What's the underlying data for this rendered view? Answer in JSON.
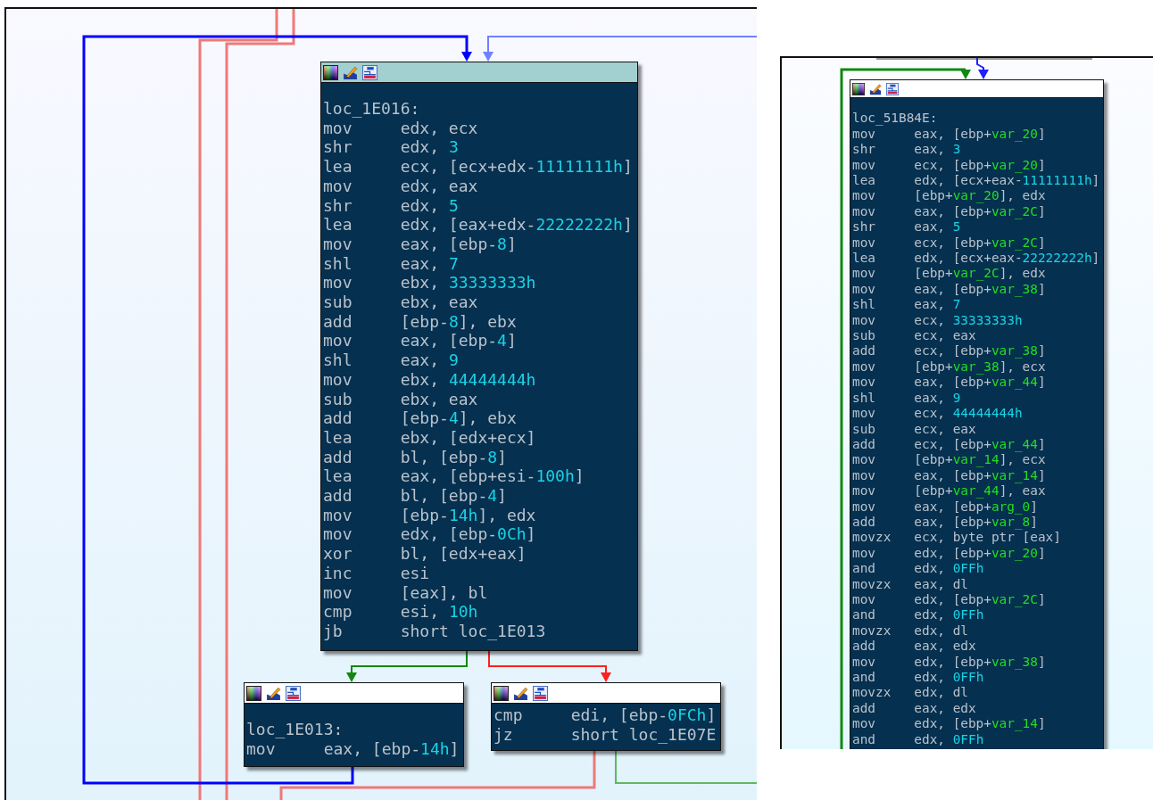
{
  "panels": [
    {
      "blocks": [
        {
          "selected": true,
          "label": "loc_1E016:",
          "lines": [
            {
              "mnemonic": "mov",
              "operands": [
                {
                  "text": "edx, ecx",
                  "kind": "plain"
                }
              ]
            },
            {
              "mnemonic": "shr",
              "operands": [
                {
                  "text": "edx, ",
                  "kind": "plain"
                },
                {
                  "text": "3",
                  "kind": "num"
                }
              ]
            },
            {
              "mnemonic": "lea",
              "operands": [
                {
                  "text": "ecx, [ecx+edx-",
                  "kind": "plain"
                },
                {
                  "text": "11111111h",
                  "kind": "num"
                },
                {
                  "text": "]",
                  "kind": "plain"
                }
              ]
            },
            {
              "mnemonic": "mov",
              "operands": [
                {
                  "text": "edx, eax",
                  "kind": "plain"
                }
              ]
            },
            {
              "mnemonic": "shr",
              "operands": [
                {
                  "text": "edx, ",
                  "kind": "plain"
                },
                {
                  "text": "5",
                  "kind": "num"
                }
              ]
            },
            {
              "mnemonic": "lea",
              "operands": [
                {
                  "text": "edx, [eax+edx-",
                  "kind": "plain"
                },
                {
                  "text": "22222222h",
                  "kind": "num"
                },
                {
                  "text": "]",
                  "kind": "plain"
                }
              ]
            },
            {
              "mnemonic": "mov",
              "operands": [
                {
                  "text": "eax, [ebp-",
                  "kind": "plain"
                },
                {
                  "text": "8",
                  "kind": "num"
                },
                {
                  "text": "]",
                  "kind": "plain"
                }
              ]
            },
            {
              "mnemonic": "shl",
              "operands": [
                {
                  "text": "eax, ",
                  "kind": "plain"
                },
                {
                  "text": "7",
                  "kind": "num"
                }
              ]
            },
            {
              "mnemonic": "mov",
              "operands": [
                {
                  "text": "ebx, ",
                  "kind": "plain"
                },
                {
                  "text": "33333333h",
                  "kind": "num"
                }
              ]
            },
            {
              "mnemonic": "sub",
              "operands": [
                {
                  "text": "ebx, eax",
                  "kind": "plain"
                }
              ]
            },
            {
              "mnemonic": "add",
              "operands": [
                {
                  "text": "[ebp-",
                  "kind": "plain"
                },
                {
                  "text": "8",
                  "kind": "num"
                },
                {
                  "text": "], ebx",
                  "kind": "plain"
                }
              ]
            },
            {
              "mnemonic": "mov",
              "operands": [
                {
                  "text": "eax, [ebp-",
                  "kind": "plain"
                },
                {
                  "text": "4",
                  "kind": "num"
                },
                {
                  "text": "]",
                  "kind": "plain"
                }
              ]
            },
            {
              "mnemonic": "shl",
              "operands": [
                {
                  "text": "eax, ",
                  "kind": "plain"
                },
                {
                  "text": "9",
                  "kind": "num"
                }
              ]
            },
            {
              "mnemonic": "mov",
              "operands": [
                {
                  "text": "ebx, ",
                  "kind": "plain"
                },
                {
                  "text": "44444444h",
                  "kind": "num"
                }
              ]
            },
            {
              "mnemonic": "sub",
              "operands": [
                {
                  "text": "ebx, eax",
                  "kind": "plain"
                }
              ]
            },
            {
              "mnemonic": "add",
              "operands": [
                {
                  "text": "[ebp-",
                  "kind": "plain"
                },
                {
                  "text": "4",
                  "kind": "num"
                },
                {
                  "text": "], ebx",
                  "kind": "plain"
                }
              ]
            },
            {
              "mnemonic": "lea",
              "operands": [
                {
                  "text": "ebx, [edx+ecx]",
                  "kind": "plain"
                }
              ]
            },
            {
              "mnemonic": "add",
              "operands": [
                {
                  "text": "bl, [ebp-",
                  "kind": "plain"
                },
                {
                  "text": "8",
                  "kind": "num"
                },
                {
                  "text": "]",
                  "kind": "plain"
                }
              ]
            },
            {
              "mnemonic": "lea",
              "operands": [
                {
                  "text": "eax, [ebp+esi-",
                  "kind": "plain"
                },
                {
                  "text": "100h",
                  "kind": "num"
                },
                {
                  "text": "]",
                  "kind": "plain"
                }
              ]
            },
            {
              "mnemonic": "add",
              "operands": [
                {
                  "text": "bl, [ebp-",
                  "kind": "plain"
                },
                {
                  "text": "4",
                  "kind": "num"
                },
                {
                  "text": "]",
                  "kind": "plain"
                }
              ]
            },
            {
              "mnemonic": "mov",
              "operands": [
                {
                  "text": "[ebp-",
                  "kind": "plain"
                },
                {
                  "text": "14h",
                  "kind": "num"
                },
                {
                  "text": "], edx",
                  "kind": "plain"
                }
              ]
            },
            {
              "mnemonic": "mov",
              "operands": [
                {
                  "text": "edx, [ebp-",
                  "kind": "plain"
                },
                {
                  "text": "0Ch",
                  "kind": "num"
                },
                {
                  "text": "]",
                  "kind": "plain"
                }
              ]
            },
            {
              "mnemonic": "xor",
              "operands": [
                {
                  "text": "bl, [edx+eax]",
                  "kind": "plain"
                }
              ]
            },
            {
              "mnemonic": "inc",
              "operands": [
                {
                  "text": "esi",
                  "kind": "plain"
                }
              ]
            },
            {
              "mnemonic": "mov",
              "operands": [
                {
                  "text": "[eax], bl",
                  "kind": "plain"
                }
              ]
            },
            {
              "mnemonic": "cmp",
              "operands": [
                {
                  "text": "esi, ",
                  "kind": "plain"
                },
                {
                  "text": "10h",
                  "kind": "num"
                }
              ]
            },
            {
              "mnemonic": "jb",
              "operands": [
                {
                  "text": "short loc_1E013",
                  "kind": "plain"
                }
              ]
            }
          ]
        },
        {
          "selected": false,
          "label": "loc_1E013:",
          "lines": [
            {
              "mnemonic": "mov",
              "operands": [
                {
                  "text": "eax, [ebp-",
                  "kind": "plain"
                },
                {
                  "text": "14h",
                  "kind": "num"
                },
                {
                  "text": "]",
                  "kind": "plain"
                }
              ]
            }
          ]
        },
        {
          "selected": false,
          "lines": [
            {
              "mnemonic": "cmp",
              "operands": [
                {
                  "text": "edi, [ebp-",
                  "kind": "plain"
                },
                {
                  "text": "0FCh",
                  "kind": "num"
                },
                {
                  "text": "]",
                  "kind": "plain"
                }
              ]
            },
            {
              "mnemonic": "jz",
              "operands": [
                {
                  "text": "short loc_1E07E",
                  "kind": "plain"
                }
              ]
            }
          ]
        }
      ]
    },
    {
      "blocks": [
        {
          "selected": false,
          "label": "loc_51B84E:",
          "lines": [
            {
              "mnemonic": "mov",
              "operands": [
                {
                  "text": "eax, [ebp+",
                  "kind": "plain"
                },
                {
                  "text": "var_20",
                  "kind": "var"
                },
                {
                  "text": "]",
                  "kind": "plain"
                }
              ]
            },
            {
              "mnemonic": "shr",
              "operands": [
                {
                  "text": "eax, ",
                  "kind": "plain"
                },
                {
                  "text": "3",
                  "kind": "num"
                }
              ]
            },
            {
              "mnemonic": "mov",
              "operands": [
                {
                  "text": "ecx, [ebp+",
                  "kind": "plain"
                },
                {
                  "text": "var_20",
                  "kind": "var"
                },
                {
                  "text": "]",
                  "kind": "plain"
                }
              ]
            },
            {
              "mnemonic": "lea",
              "operands": [
                {
                  "text": "edx, [ecx+eax-",
                  "kind": "plain"
                },
                {
                  "text": "11111111h",
                  "kind": "num"
                },
                {
                  "text": "]",
                  "kind": "plain"
                }
              ]
            },
            {
              "mnemonic": "mov",
              "operands": [
                {
                  "text": "[ebp+",
                  "kind": "plain"
                },
                {
                  "text": "var_20",
                  "kind": "var"
                },
                {
                  "text": "], edx",
                  "kind": "plain"
                }
              ]
            },
            {
              "mnemonic": "mov",
              "operands": [
                {
                  "text": "eax, [ebp+",
                  "kind": "plain"
                },
                {
                  "text": "var_2C",
                  "kind": "var"
                },
                {
                  "text": "]",
                  "kind": "plain"
                }
              ]
            },
            {
              "mnemonic": "shr",
              "operands": [
                {
                  "text": "eax, ",
                  "kind": "plain"
                },
                {
                  "text": "5",
                  "kind": "num"
                }
              ]
            },
            {
              "mnemonic": "mov",
              "operands": [
                {
                  "text": "ecx, [ebp+",
                  "kind": "plain"
                },
                {
                  "text": "var_2C",
                  "kind": "var"
                },
                {
                  "text": "]",
                  "kind": "plain"
                }
              ]
            },
            {
              "mnemonic": "lea",
              "operands": [
                {
                  "text": "edx, [ecx+eax-",
                  "kind": "plain"
                },
                {
                  "text": "22222222h",
                  "kind": "num"
                },
                {
                  "text": "]",
                  "kind": "plain"
                }
              ]
            },
            {
              "mnemonic": "mov",
              "operands": [
                {
                  "text": "[ebp+",
                  "kind": "plain"
                },
                {
                  "text": "var_2C",
                  "kind": "var"
                },
                {
                  "text": "], edx",
                  "kind": "plain"
                }
              ]
            },
            {
              "mnemonic": "mov",
              "operands": [
                {
                  "text": "eax, [ebp+",
                  "kind": "plain"
                },
                {
                  "text": "var_38",
                  "kind": "var"
                },
                {
                  "text": "]",
                  "kind": "plain"
                }
              ]
            },
            {
              "mnemonic": "shl",
              "operands": [
                {
                  "text": "eax, ",
                  "kind": "plain"
                },
                {
                  "text": "7",
                  "kind": "num"
                }
              ]
            },
            {
              "mnemonic": "mov",
              "operands": [
                {
                  "text": "ecx, ",
                  "kind": "plain"
                },
                {
                  "text": "33333333h",
                  "kind": "num"
                }
              ]
            },
            {
              "mnemonic": "sub",
              "operands": [
                {
                  "text": "ecx, eax",
                  "kind": "plain"
                }
              ]
            },
            {
              "mnemonic": "add",
              "operands": [
                {
                  "text": "ecx, [ebp+",
                  "kind": "plain"
                },
                {
                  "text": "var_38",
                  "kind": "var"
                },
                {
                  "text": "]",
                  "kind": "plain"
                }
              ]
            },
            {
              "mnemonic": "mov",
              "operands": [
                {
                  "text": "[ebp+",
                  "kind": "plain"
                },
                {
                  "text": "var_38",
                  "kind": "var"
                },
                {
                  "text": "], ecx",
                  "kind": "plain"
                }
              ]
            },
            {
              "mnemonic": "mov",
              "operands": [
                {
                  "text": "eax, [ebp+",
                  "kind": "plain"
                },
                {
                  "text": "var_44",
                  "kind": "var"
                },
                {
                  "text": "]",
                  "kind": "plain"
                }
              ]
            },
            {
              "mnemonic": "shl",
              "operands": [
                {
                  "text": "eax, ",
                  "kind": "plain"
                },
                {
                  "text": "9",
                  "kind": "num"
                }
              ]
            },
            {
              "mnemonic": "mov",
              "operands": [
                {
                  "text": "ecx, ",
                  "kind": "plain"
                },
                {
                  "text": "44444444h",
                  "kind": "num"
                }
              ]
            },
            {
              "mnemonic": "sub",
              "operands": [
                {
                  "text": "ecx, eax",
                  "kind": "plain"
                }
              ]
            },
            {
              "mnemonic": "add",
              "operands": [
                {
                  "text": "ecx, [ebp+",
                  "kind": "plain"
                },
                {
                  "text": "var_44",
                  "kind": "var"
                },
                {
                  "text": "]",
                  "kind": "plain"
                }
              ]
            },
            {
              "mnemonic": "mov",
              "operands": [
                {
                  "text": "[ebp+",
                  "kind": "plain"
                },
                {
                  "text": "var_14",
                  "kind": "var"
                },
                {
                  "text": "], ecx",
                  "kind": "plain"
                }
              ]
            },
            {
              "mnemonic": "mov",
              "operands": [
                {
                  "text": "eax, [ebp+",
                  "kind": "plain"
                },
                {
                  "text": "var_14",
                  "kind": "var"
                },
                {
                  "text": "]",
                  "kind": "plain"
                }
              ]
            },
            {
              "mnemonic": "mov",
              "operands": [
                {
                  "text": "[ebp+",
                  "kind": "plain"
                },
                {
                  "text": "var_44",
                  "kind": "var"
                },
                {
                  "text": "], eax",
                  "kind": "plain"
                }
              ]
            },
            {
              "mnemonic": "mov",
              "operands": [
                {
                  "text": "eax, [ebp+",
                  "kind": "plain"
                },
                {
                  "text": "arg_0",
                  "kind": "var"
                },
                {
                  "text": "]",
                  "kind": "plain"
                }
              ]
            },
            {
              "mnemonic": "add",
              "operands": [
                {
                  "text": "eax, [ebp+",
                  "kind": "plain"
                },
                {
                  "text": "var_8",
                  "kind": "var"
                },
                {
                  "text": "]",
                  "kind": "plain"
                }
              ]
            },
            {
              "mnemonic": "movzx",
              "operands": [
                {
                  "text": "ecx, byte ptr [eax]",
                  "kind": "plain"
                }
              ]
            },
            {
              "mnemonic": "mov",
              "operands": [
                {
                  "text": "edx, [ebp+",
                  "kind": "plain"
                },
                {
                  "text": "var_20",
                  "kind": "var"
                },
                {
                  "text": "]",
                  "kind": "plain"
                }
              ]
            },
            {
              "mnemonic": "and",
              "operands": [
                {
                  "text": "edx, ",
                  "kind": "plain"
                },
                {
                  "text": "0FFh",
                  "kind": "num"
                }
              ]
            },
            {
              "mnemonic": "movzx",
              "operands": [
                {
                  "text": "eax, dl",
                  "kind": "plain"
                }
              ]
            },
            {
              "mnemonic": "mov",
              "operands": [
                {
                  "text": "edx, [ebp+",
                  "kind": "plain"
                },
                {
                  "text": "var_2C",
                  "kind": "var"
                },
                {
                  "text": "]",
                  "kind": "plain"
                }
              ]
            },
            {
              "mnemonic": "and",
              "operands": [
                {
                  "text": "edx, ",
                  "kind": "plain"
                },
                {
                  "text": "0FFh",
                  "kind": "num"
                }
              ]
            },
            {
              "mnemonic": "movzx",
              "operands": [
                {
                  "text": "edx, dl",
                  "kind": "plain"
                }
              ]
            },
            {
              "mnemonic": "add",
              "operands": [
                {
                  "text": "eax, edx",
                  "kind": "plain"
                }
              ]
            },
            {
              "mnemonic": "mov",
              "operands": [
                {
                  "text": "edx, [ebp+",
                  "kind": "plain"
                },
                {
                  "text": "var_38",
                  "kind": "var"
                },
                {
                  "text": "]",
                  "kind": "plain"
                }
              ]
            },
            {
              "mnemonic": "and",
              "operands": [
                {
                  "text": "edx, ",
                  "kind": "plain"
                },
                {
                  "text": "0FFh",
                  "kind": "num"
                }
              ]
            },
            {
              "mnemonic": "movzx",
              "operands": [
                {
                  "text": "edx, dl",
                  "kind": "plain"
                }
              ]
            },
            {
              "mnemonic": "add",
              "operands": [
                {
                  "text": "eax, edx",
                  "kind": "plain"
                }
              ]
            },
            {
              "mnemonic": "mov",
              "operands": [
                {
                  "text": "edx, [ebp+",
                  "kind": "plain"
                },
                {
                  "text": "var_14",
                  "kind": "var"
                },
                {
                  "text": "]",
                  "kind": "plain"
                }
              ]
            },
            {
              "mnemonic": "and",
              "operands": [
                {
                  "text": "edx, ",
                  "kind": "plain"
                },
                {
                  "text": "0FFh",
                  "kind": "num"
                }
              ]
            }
          ]
        }
      ]
    }
  ]
}
